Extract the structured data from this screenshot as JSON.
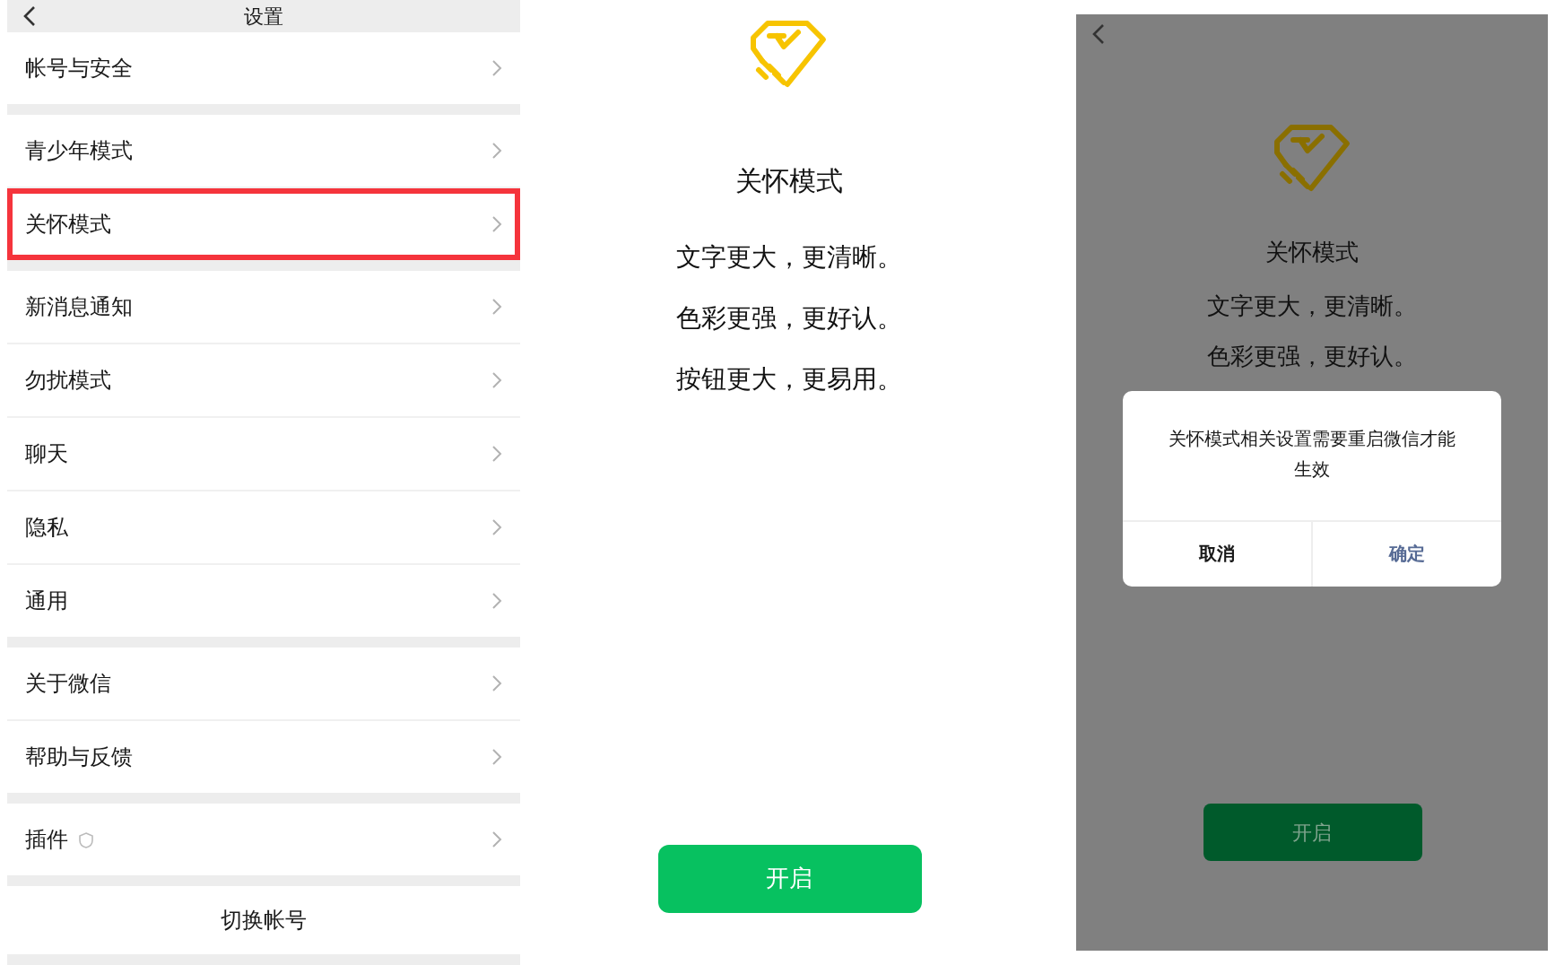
{
  "settings": {
    "title": "设置",
    "groups": [
      [
        {
          "label": "帐号与安全",
          "selected": false,
          "kind": "plain"
        }
      ],
      [
        {
          "label": "青少年模式",
          "selected": false,
          "kind": "plain"
        },
        {
          "label": "关怀模式",
          "selected": true,
          "kind": "plain"
        }
      ],
      [
        {
          "label": "新消息通知",
          "selected": false,
          "kind": "plain"
        },
        {
          "label": "勿扰模式",
          "selected": false,
          "kind": "plain"
        },
        {
          "label": "聊天",
          "selected": false,
          "kind": "plain"
        },
        {
          "label": "隐私",
          "selected": false,
          "kind": "plain"
        },
        {
          "label": "通用",
          "selected": false,
          "kind": "plain"
        }
      ],
      [
        {
          "label": "关于微信",
          "selected": false,
          "kind": "plain"
        },
        {
          "label": "帮助与反馈",
          "selected": false,
          "kind": "plain"
        }
      ],
      [
        {
          "label": "插件",
          "selected": false,
          "kind": "with-icon"
        }
      ]
    ],
    "switch_account": "切换帐号"
  },
  "intro": {
    "title": "关怀模式",
    "lines": [
      "文字更大，更清晰。",
      "色彩更强，更好认。",
      "按钮更大，更易用。"
    ],
    "button": "开启"
  },
  "confirm_screen": {
    "title": "关怀模式",
    "lines": [
      "文字更大，更清晰。",
      "色彩更强，更好认。"
    ],
    "button": "开启",
    "dialog": {
      "message": "关怀模式相关设置需要重启微信才能生效",
      "buttons": [
        {
          "label": "取消",
          "kind": "cancel"
        },
        {
          "label": "确定",
          "kind": "confirm"
        }
      ]
    }
  }
}
